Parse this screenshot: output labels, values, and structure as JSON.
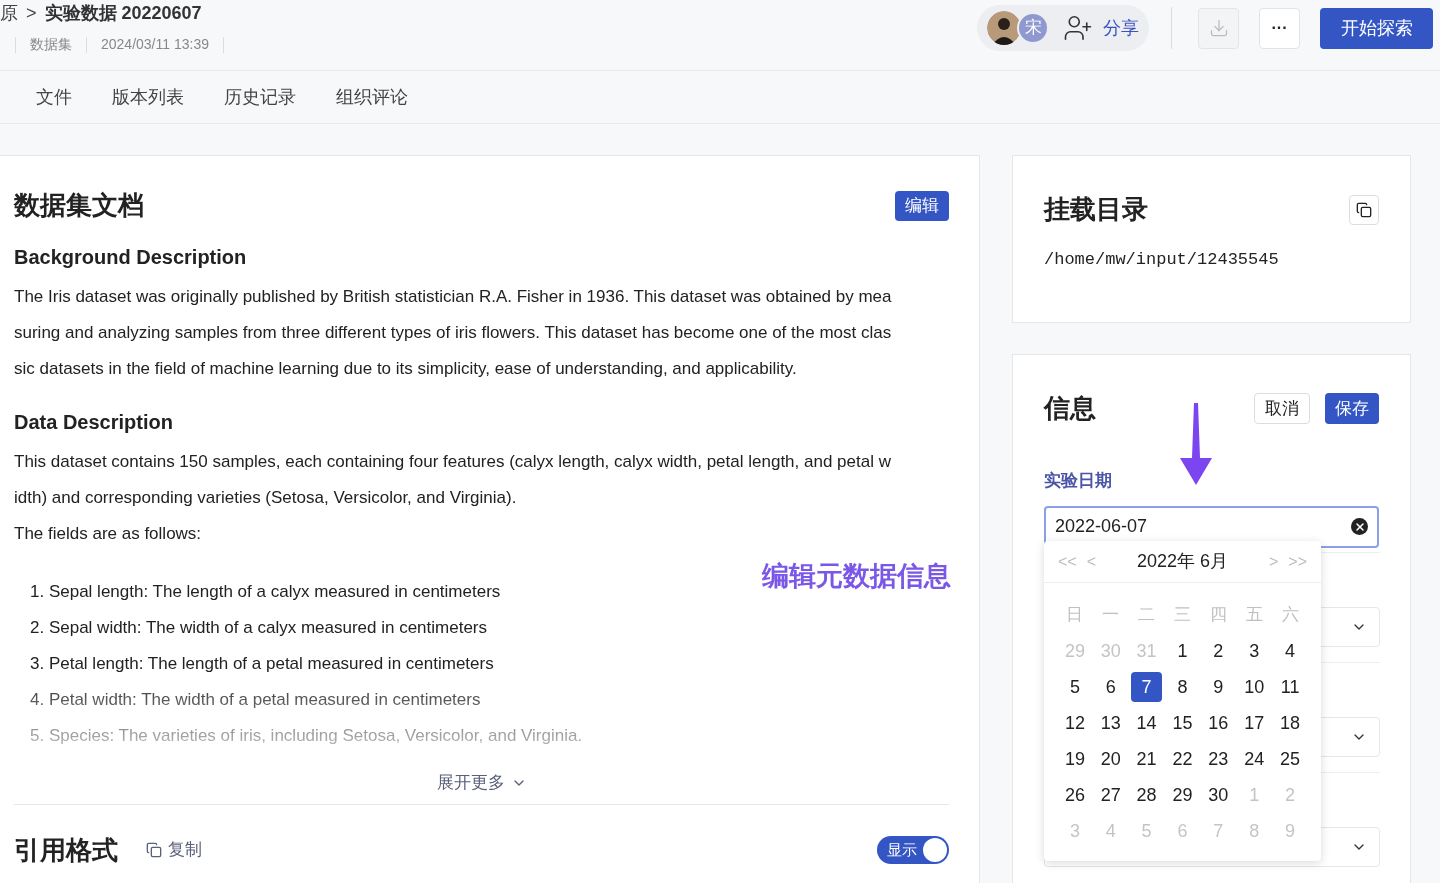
{
  "breadcrumb": {
    "parent": "原",
    "separator": ">",
    "title": "实验数据 20220607"
  },
  "meta": [
    "数据集",
    "2024/03/11 13:39"
  ],
  "header": {
    "avatar_initial": "宋",
    "share": "分享",
    "more": "···",
    "primary": "开始探索"
  },
  "tabs": [
    {
      "label": "文件",
      "selected": false
    },
    {
      "label": "版本列表",
      "selected": false
    },
    {
      "label": "历史记录",
      "selected": false
    },
    {
      "label": "组织评论",
      "selected": false
    }
  ],
  "doc": {
    "title": "数据集文档",
    "edit": "编辑",
    "sections": [
      {
        "heading": "Background Description",
        "paragraphs": [
          "The Iris dataset was originally published by British statistician R.A. Fisher in 1936. This dataset was obtained by mea",
          "suring and analyzing samples from three different types of iris flowers. This dataset has become one of the most clas",
          "sic datasets in the field of machine learning due to its simplicity, ease of understanding, and applicability."
        ]
      },
      {
        "heading": "Data Description",
        "paragraphs": [
          "This dataset contains 150 samples, each containing four features (calyx length, calyx width, petal length, and petal w",
          "idth) and corresponding varieties (Setosa, Versicolor, and Virginia).",
          "The fields are as follows:"
        ]
      }
    ],
    "list": [
      "1. Sepal length: The length of a calyx measured in centimeters",
      "2. Sepal width: The width of a calyx measured in centimeters",
      "3. Petal length: The length of a petal measured in centimeters",
      "4. Petal width: The width of a petal measured in centimeters",
      "5. Species: The varieties of iris, including Setosa, Versicolor, and Virginia."
    ],
    "expand": "展开更多",
    "annotation": "编辑元数据信息"
  },
  "citation": {
    "title": "引用格式",
    "copy": "复制",
    "toggle_label": "显示",
    "on": true
  },
  "mount": {
    "title": "挂载目录",
    "path": "/home/mw/input/12435545"
  },
  "info": {
    "title": "信息",
    "cancel": "取消",
    "save": "保存",
    "field_label": "实验日期",
    "value": "2022-06-07"
  },
  "calendar": {
    "prev_year": "<<",
    "prev": "<",
    "month": "2022年 6月",
    "next": ">",
    "next_year": ">>",
    "weekdays": [
      "日",
      "一",
      "二",
      "三",
      "四",
      "五",
      "六"
    ],
    "weeks": [
      [
        {
          "day": "29",
          "in_month": false,
          "selected": false
        },
        {
          "day": "30",
          "in_month": false,
          "selected": false
        },
        {
          "day": "31",
          "in_month": false,
          "selected": false
        },
        {
          "day": "1",
          "in_month": true,
          "selected": false
        },
        {
          "day": "2",
          "in_month": true,
          "selected": false
        },
        {
          "day": "3",
          "in_month": true,
          "selected": false
        },
        {
          "day": "4",
          "in_month": true,
          "selected": false
        }
      ],
      [
        {
          "day": "5",
          "in_month": true,
          "selected": false
        },
        {
          "day": "6",
          "in_month": true,
          "selected": false
        },
        {
          "day": "7",
          "in_month": true,
          "selected": true
        },
        {
          "day": "8",
          "in_month": true,
          "selected": false
        },
        {
          "day": "9",
          "in_month": true,
          "selected": false
        },
        {
          "day": "10",
          "in_month": true,
          "selected": false
        },
        {
          "day": "11",
          "in_month": true,
          "selected": false
        }
      ],
      [
        {
          "day": "12",
          "in_month": true,
          "selected": false
        },
        {
          "day": "13",
          "in_month": true,
          "selected": false
        },
        {
          "day": "14",
          "in_month": true,
          "selected": false
        },
        {
          "day": "15",
          "in_month": true,
          "selected": false
        },
        {
          "day": "16",
          "in_month": true,
          "selected": false
        },
        {
          "day": "17",
          "in_month": true,
          "selected": false
        },
        {
          "day": "18",
          "in_month": true,
          "selected": false
        }
      ],
      [
        {
          "day": "19",
          "in_month": true,
          "selected": false
        },
        {
          "day": "20",
          "in_month": true,
          "selected": false
        },
        {
          "day": "21",
          "in_month": true,
          "selected": false
        },
        {
          "day": "22",
          "in_month": true,
          "selected": false
        },
        {
          "day": "23",
          "in_month": true,
          "selected": false
        },
        {
          "day": "24",
          "in_month": true,
          "selected": false
        },
        {
          "day": "25",
          "in_month": true,
          "selected": false
        }
      ],
      [
        {
          "day": "26",
          "in_month": true,
          "selected": false
        },
        {
          "day": "27",
          "in_month": true,
          "selected": false
        },
        {
          "day": "28",
          "in_month": true,
          "selected": false
        },
        {
          "day": "29",
          "in_month": true,
          "selected": false
        },
        {
          "day": "30",
          "in_month": true,
          "selected": false
        },
        {
          "day": "1",
          "in_month": false,
          "selected": false
        },
        {
          "day": "2",
          "in_month": false,
          "selected": false
        }
      ],
      [
        {
          "day": "3",
          "in_month": false,
          "selected": false
        },
        {
          "day": "4",
          "in_month": false,
          "selected": false
        },
        {
          "day": "5",
          "in_month": false,
          "selected": false
        },
        {
          "day": "6",
          "in_month": false,
          "selected": false
        },
        {
          "day": "7",
          "in_month": false,
          "selected": false
        },
        {
          "day": "8",
          "in_month": false,
          "selected": false
        },
        {
          "day": "9",
          "in_month": false,
          "selected": false
        }
      ]
    ]
  }
}
